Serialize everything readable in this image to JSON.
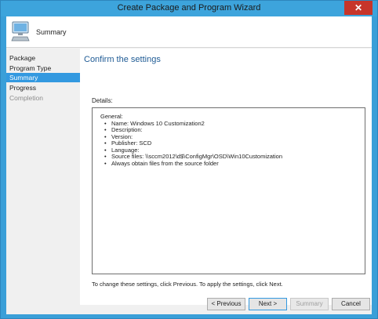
{
  "window": {
    "title": "Create Package and Program Wizard",
    "close_glyph": "✕"
  },
  "header": {
    "title": "Summary",
    "icon": "computer-icon"
  },
  "nav": {
    "items": [
      {
        "label": "Package",
        "state": "normal"
      },
      {
        "label": "Program Type",
        "state": "normal"
      },
      {
        "label": "Summary",
        "state": "active"
      },
      {
        "label": "Progress",
        "state": "normal"
      },
      {
        "label": "Completion",
        "state": "disabled"
      }
    ]
  },
  "main": {
    "section_title": "Confirm the settings",
    "details_label": "Details:",
    "details": {
      "heading": "General:",
      "lines": [
        "Name: Windows 10 Customization2",
        "Description:",
        "Version:",
        "Publisher: SCD",
        "Language:",
        "Source files: \\\\sccm2012\\d$\\ConfigMgr\\OSD\\Win10Customization",
        "Always obtain files from the source folder"
      ]
    },
    "footnote": "To change these settings, click Previous. To apply the settings, click Next."
  },
  "buttons": {
    "previous": "< Previous",
    "next": "Next >",
    "summary": "Summary",
    "cancel": "Cancel"
  },
  "colors": {
    "title_bar": "#3da4dc",
    "nav_active": "#3399e0",
    "section_title": "#1f5b95",
    "close_button": "#c7352a"
  }
}
